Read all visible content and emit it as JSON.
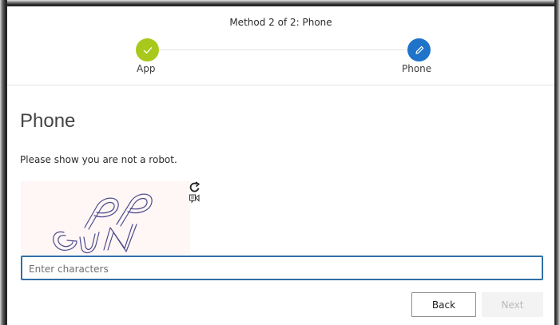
{
  "header": {
    "method_title": "Method 2 of 2: Phone",
    "steps": [
      {
        "label": "App",
        "state": "complete",
        "icon": "checkmark-icon",
        "color": "#a8c81b"
      },
      {
        "label": "Phone",
        "state": "current",
        "icon": "pencil-icon",
        "color": "#1f73c9"
      }
    ]
  },
  "main": {
    "title": "Phone",
    "prompt": "Please show you are not a robot.",
    "captcha": {
      "characters_shown": "PP GJN",
      "refresh_icon": "refresh-icon",
      "audio_icon": "audio-captcha-icon"
    },
    "input": {
      "placeholder": "Enter characters",
      "value": ""
    }
  },
  "footer": {
    "back_label": "Back",
    "next_label": "Next"
  },
  "colors": {
    "accent": "#1f73c9",
    "success": "#a8c81b",
    "input_border": "#2f6fa7"
  }
}
